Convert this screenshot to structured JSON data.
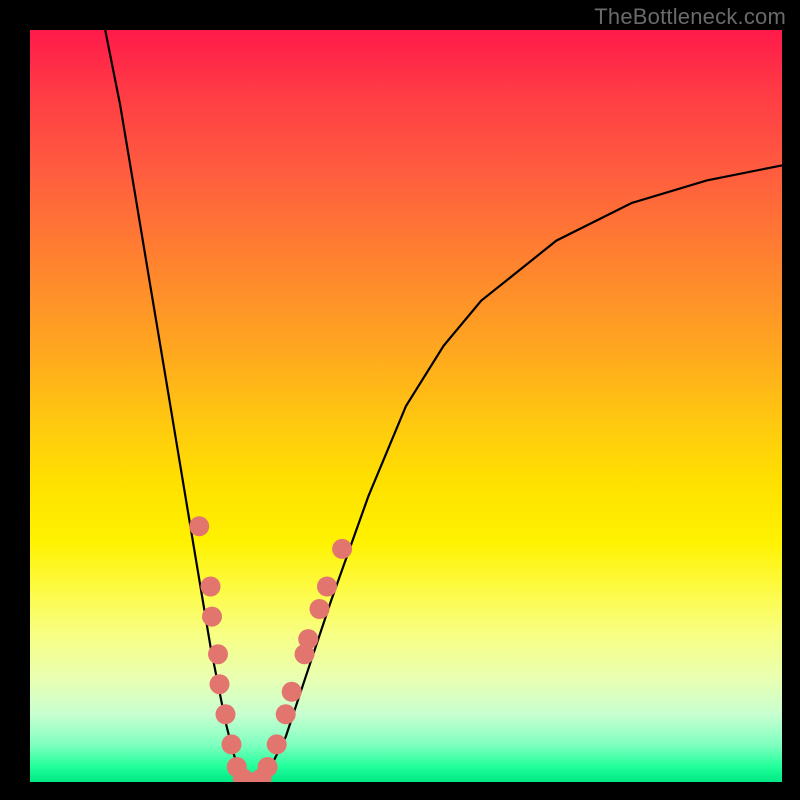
{
  "watermark": "TheBottleneck.com",
  "chart_data": {
    "type": "line",
    "title": "",
    "xlabel": "",
    "ylabel": "",
    "xlim": [
      0,
      100
    ],
    "ylim": [
      0,
      100
    ],
    "series": [
      {
        "name": "bottleneck-curve",
        "x": [
          10,
          12,
          14,
          16,
          18,
          20,
          22,
          24,
          26,
          27,
          28,
          29,
          30,
          32,
          34,
          36,
          40,
          45,
          50,
          55,
          60,
          70,
          80,
          90,
          100
        ],
        "y": [
          100,
          90,
          78,
          66,
          54,
          42,
          30,
          18,
          8,
          4,
          1,
          0,
          0,
          2,
          6,
          12,
          24,
          38,
          50,
          58,
          64,
          72,
          77,
          80,
          82
        ]
      }
    ],
    "markers": {
      "name": "highlight-cluster",
      "color": "#e2766f",
      "points": [
        {
          "x": 22.5,
          "y": 34
        },
        {
          "x": 24.0,
          "y": 26
        },
        {
          "x": 24.2,
          "y": 22
        },
        {
          "x": 25.0,
          "y": 17
        },
        {
          "x": 25.2,
          "y": 13
        },
        {
          "x": 26.0,
          "y": 9
        },
        {
          "x": 26.8,
          "y": 5
        },
        {
          "x": 27.5,
          "y": 2
        },
        {
          "x": 28.3,
          "y": 0.5
        },
        {
          "x": 29.2,
          "y": 0
        },
        {
          "x": 30.0,
          "y": 0
        },
        {
          "x": 30.8,
          "y": 0.5
        },
        {
          "x": 31.6,
          "y": 2
        },
        {
          "x": 32.8,
          "y": 5
        },
        {
          "x": 34.0,
          "y": 9
        },
        {
          "x": 34.8,
          "y": 12
        },
        {
          "x": 36.5,
          "y": 17
        },
        {
          "x": 37.0,
          "y": 19
        },
        {
          "x": 38.5,
          "y": 23
        },
        {
          "x": 39.5,
          "y": 26
        },
        {
          "x": 41.5,
          "y": 31
        }
      ]
    },
    "gradient_axis": "y",
    "gradient_stops": [
      {
        "pos": 0,
        "color": "#00e884"
      },
      {
        "pos": 50,
        "color": "#ffe000"
      },
      {
        "pos": 100,
        "color": "#ff1a4a"
      }
    ]
  }
}
